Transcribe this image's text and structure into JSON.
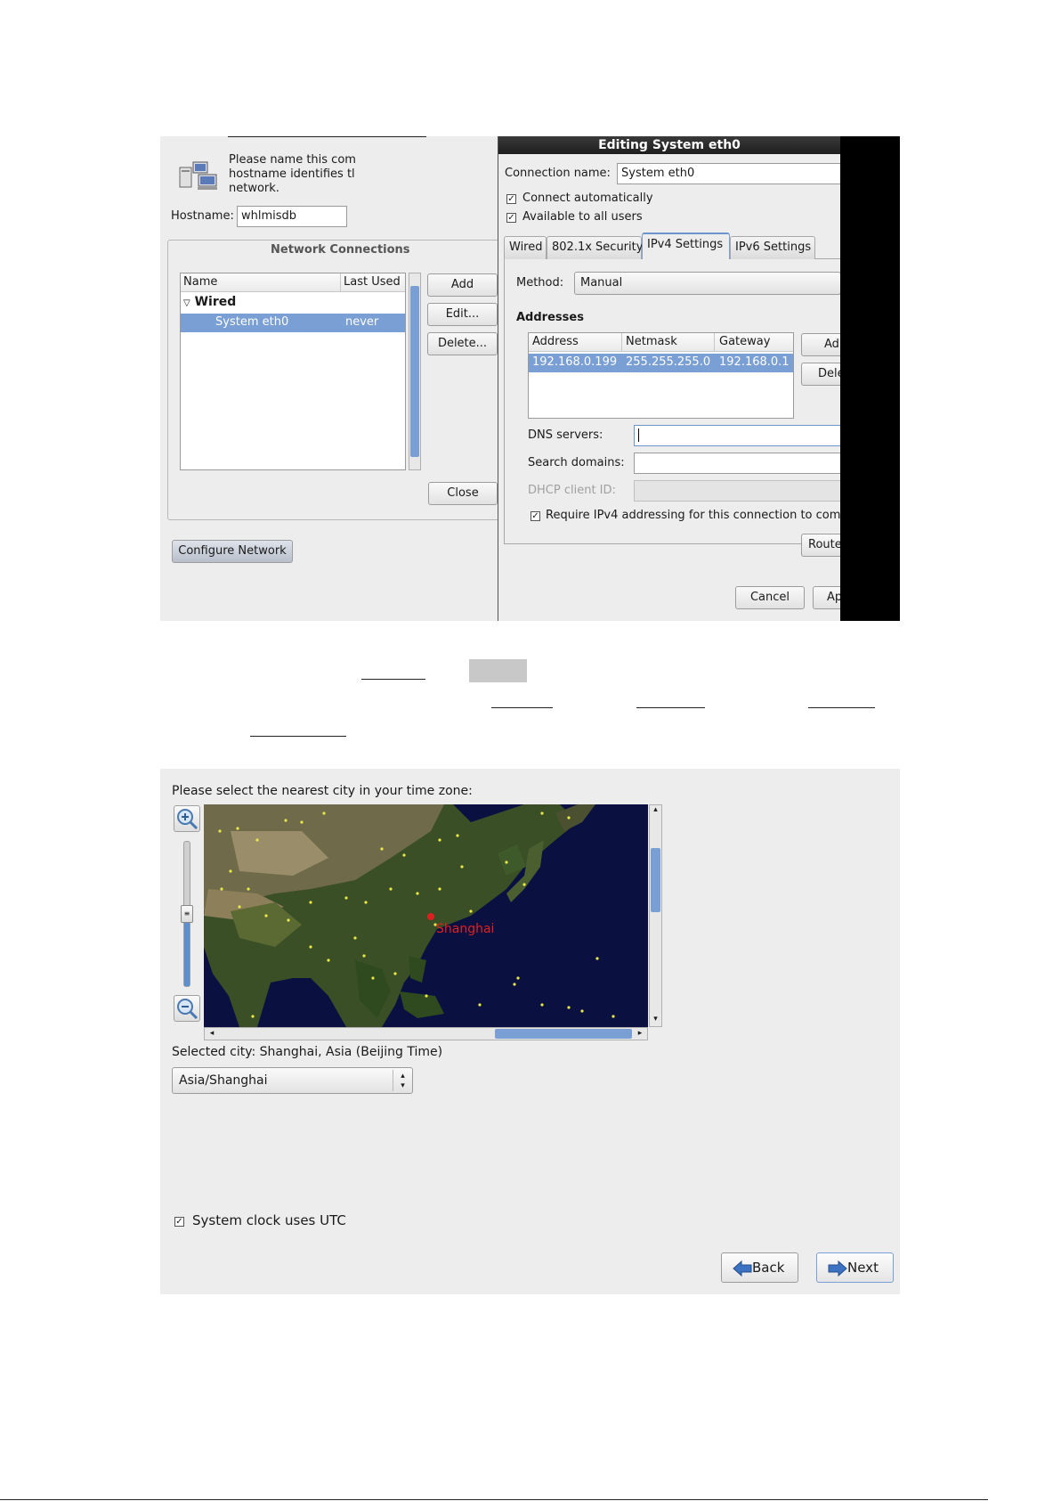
{
  "network_dialog": {
    "intro_text": [
      "Please name this com",
      "hostname identifies tl",
      "network."
    ],
    "hostname_label": "Hostname:",
    "hostname_value": "whlmisdb",
    "connections_title": "Network Connections",
    "columns": [
      "Name",
      "Last Used"
    ],
    "group_label": "Wired",
    "connection": {
      "name": "System eth0",
      "last_used": "never"
    },
    "buttons": {
      "add": "Add",
      "edit": "Edit...",
      "delete": "Delete...",
      "close": "Close"
    },
    "configure_button": "Configure Network"
  },
  "edit_dialog": {
    "title": "Editing System eth0",
    "connection_name_label": "Connection name:",
    "connection_name_value": "System eth0",
    "connect_automatically": "Connect automatically",
    "available_to_all": "Available to all users",
    "tabs": [
      "Wired",
      "802.1x Security",
      "IPv4 Settings",
      "IPv6 Settings"
    ],
    "method_label": "Method:",
    "method_value": "Manual",
    "addresses_heading": "Addresses",
    "address_columns": [
      "Address",
      "Netmask",
      "Gateway"
    ],
    "address_row": [
      "192.168.0.199",
      "255.255.255.0",
      "192.168.0.1"
    ],
    "add_btn": "Ad",
    "delete_btn": "Dele",
    "dns_label": "DNS servers:",
    "search_label": "Search domains:",
    "dhcp_label": "DHCP client ID:",
    "require_ipv4": "Require IPv4 addressing for this connection to comp",
    "routes_btn": "Routes",
    "cancel_btn": "Cancel",
    "apply_btn": "Ap"
  },
  "timezone": {
    "prompt": "Please select the nearest city in your time zone:",
    "map_city_label": "Shanghai",
    "selected_city": "Selected city: Shanghai, Asia (Beijing Time)",
    "timezone_value": "Asia/Shanghai",
    "utc_label": "System clock uses UTC",
    "back_button": "Back",
    "next_button": "Next"
  },
  "colors": {
    "selection": "#7a9fd4",
    "map_ocean": "#0a1040",
    "city_dot": "#e8e84a",
    "selected_city": "#e02020"
  }
}
